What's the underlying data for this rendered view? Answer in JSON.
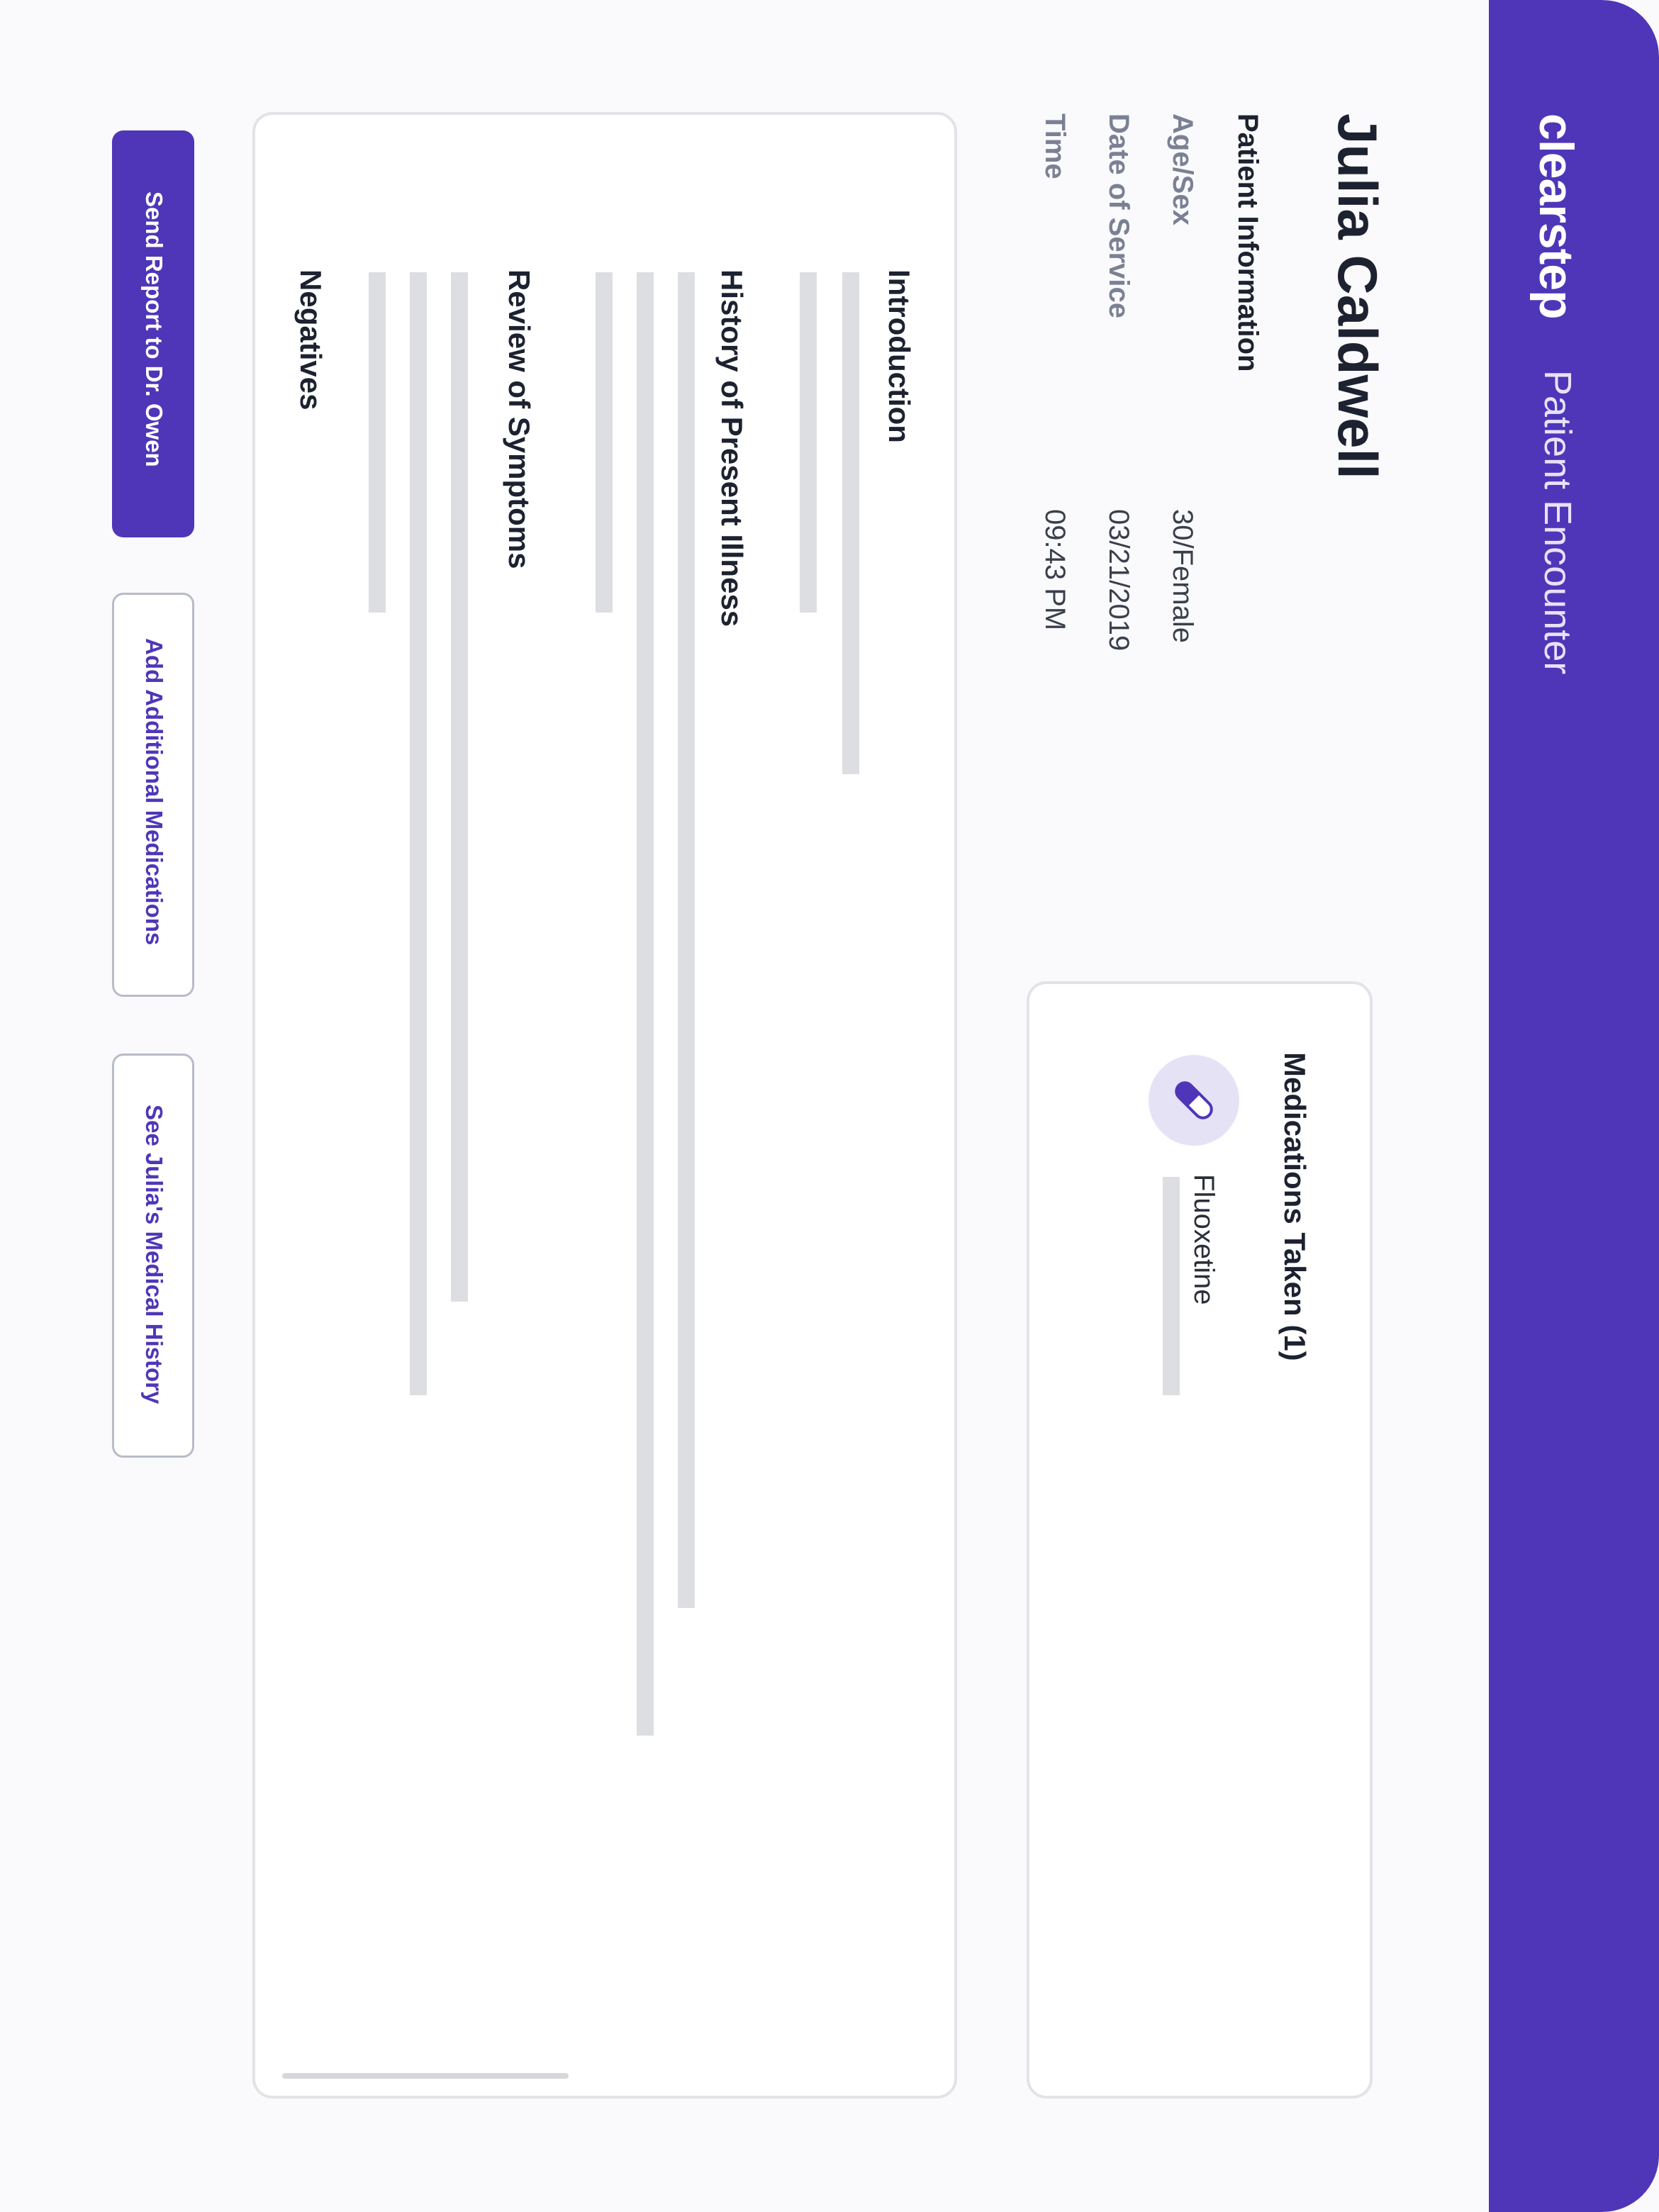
{
  "header": {
    "brand": "clearstep",
    "subtitle": "Patient Encounter",
    "collapse_icon": "chevron-up-icon"
  },
  "patient": {
    "name": "Julia Caldwell",
    "section_title": "Patient Information",
    "fields": [
      {
        "label": "Age/Sex",
        "value": "30/Female"
      },
      {
        "label": "Date of Service",
        "value": "03/21/2019"
      },
      {
        "label": "Time",
        "value": "09:43 PM"
      }
    ]
  },
  "medications": {
    "title": "Medications Taken (1)",
    "items": [
      {
        "name": "Fluoxetine",
        "icon": "pill-icon"
      }
    ]
  },
  "report": {
    "sections": [
      "Introduction",
      "History of Present Illness",
      "Review of Symptoms",
      "Negatives"
    ]
  },
  "actions": {
    "send": "Send Report to Dr. Owen",
    "add_meds": "Add Additional Medications",
    "history": "See Julia's Medical History"
  },
  "colors": {
    "brand": "#4f36b8",
    "pill_bg": "#e6e2f6",
    "placeholder": "#dcdee1"
  }
}
